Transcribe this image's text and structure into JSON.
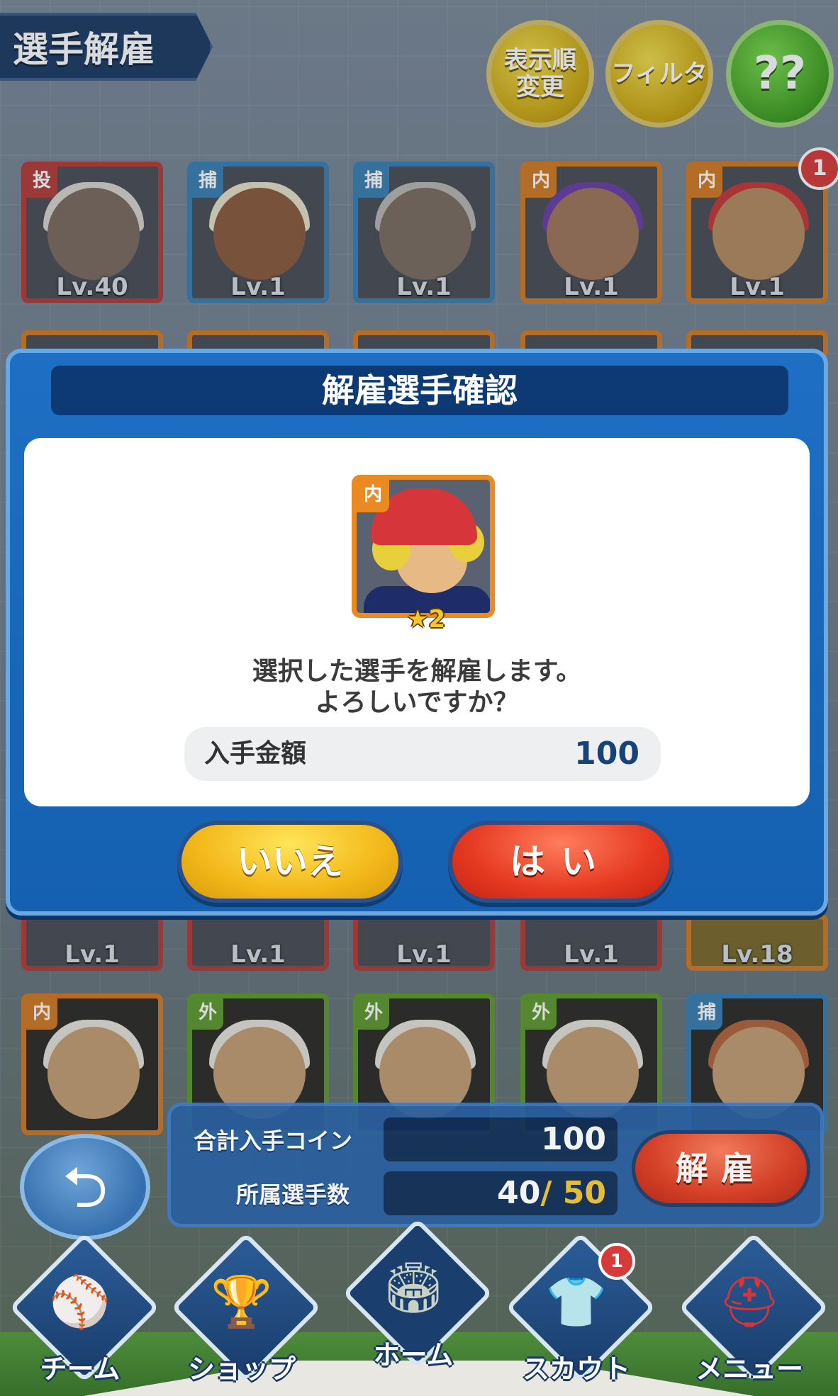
{
  "header": {
    "title": "選手解雇",
    "sort_button": "表示順\n変更",
    "filter_button": "フィルタ",
    "help_button": "??"
  },
  "roster_row1": [
    {
      "pos": "投",
      "level": "Lv.40",
      "color": "red"
    },
    {
      "pos": "捕",
      "level": "Lv.1",
      "color": "blue"
    },
    {
      "pos": "捕",
      "level": "Lv.1",
      "color": "blue"
    },
    {
      "pos": "内",
      "level": "Lv.1",
      "color": "orange"
    },
    {
      "pos": "内",
      "level": "Lv.1",
      "color": "orange",
      "badge": "1"
    }
  ],
  "roster_row3_levels": [
    "Lv.1",
    "Lv.1",
    "Lv.1",
    "Lv.1",
    "Lv.18"
  ],
  "roster_row4": [
    {
      "pos": "内"
    },
    {
      "pos": "外"
    },
    {
      "pos": "外"
    },
    {
      "pos": "外"
    },
    {
      "pos": "捕"
    }
  ],
  "dialog": {
    "title": "解雇選手確認",
    "card_pos": "内",
    "card_stars": "★2",
    "message_line1": "選択した選手を解雇します。",
    "message_line2": "よろしいですか？",
    "price_label": "入手金額",
    "price_value": "100",
    "no_button": "いいえ",
    "yes_button": "はい"
  },
  "summary": {
    "total_coins_label": "合計入手コイン",
    "total_coins_value": "100",
    "player_count_label": "所属選手数",
    "player_count": "40",
    "player_count_sep": "/",
    "player_max": "50",
    "fire_button": "解雇"
  },
  "nav": {
    "items": [
      {
        "label": "チーム"
      },
      {
        "label": "ショップ"
      },
      {
        "label": "ホーム"
      },
      {
        "label": "スカウト",
        "badge": "1"
      },
      {
        "label": "メニュー"
      }
    ]
  },
  "colors": {
    "modal_blue": "#1e6fc4",
    "yes_red": "#e63a22",
    "no_yellow": "#f3b81a",
    "accent_gold": "#f2c634"
  }
}
